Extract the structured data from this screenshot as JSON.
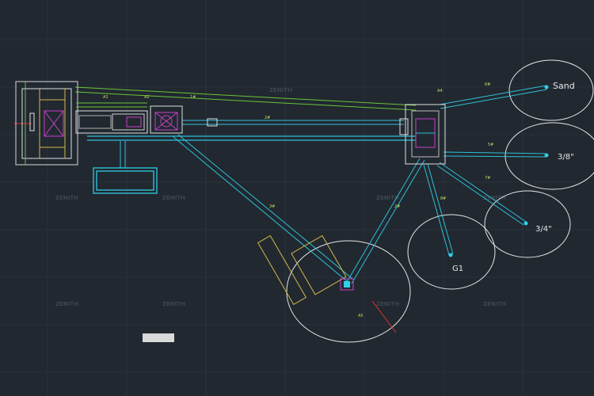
{
  "drawing": {
    "pile_labels": {
      "sand": "Sand",
      "three_eighths": "3/8\"",
      "three_quarters": "3/4\"",
      "g1": "G1",
      "main_pile": ""
    },
    "watermark": "ZENITH",
    "view_tag": "",
    "building_label": ""
  }
}
